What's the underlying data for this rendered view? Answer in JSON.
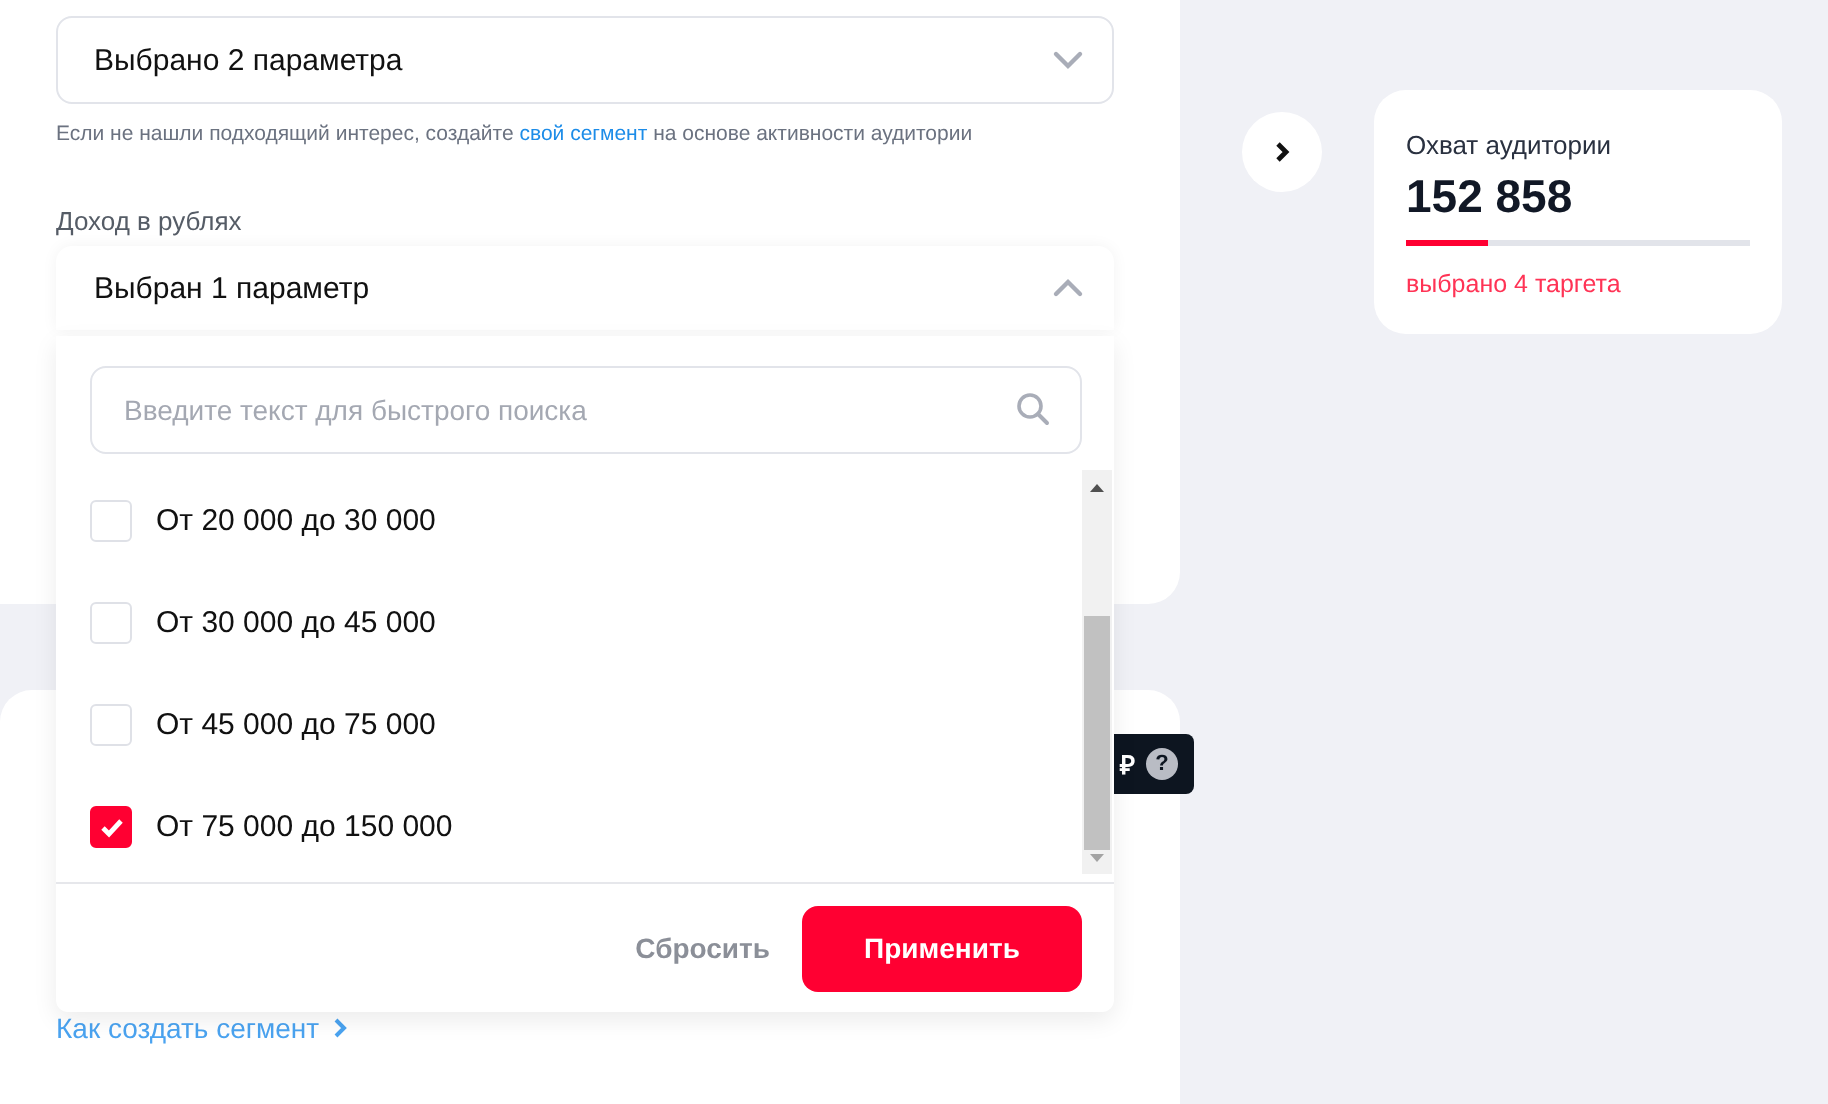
{
  "interests_field": {
    "value": "Выбрано 2 параметра",
    "expanded": false
  },
  "interests_hint": {
    "text_before": "Если не нашли подходящий интерес, создайте ",
    "link": "свой сегмент",
    "text_after": " на основе активности аудитории"
  },
  "income": {
    "label": "Доход в рублях",
    "value": "Выбран 1 параметр",
    "expanded": true,
    "search": {
      "placeholder": "Введите текст для быстрого поиска"
    },
    "options": [
      {
        "label": "От 20 000 до 30 000",
        "checked": false
      },
      {
        "label": "От 30 000 до 45 000",
        "checked": false
      },
      {
        "label": "От 45 000 до 75 000",
        "checked": false
      },
      {
        "label": "От 75 000 до 150 000",
        "checked": true
      }
    ],
    "reset_button": "Сбросить",
    "apply_button": "Применить"
  },
  "segment_link": "Как создать сегмент",
  "tooltip": {
    "text": "₽",
    "help": "?"
  },
  "reach": {
    "title": "Охват аудитории",
    "value": "152 858",
    "level": 0.24,
    "note": "выбрано 4 таргета"
  }
}
